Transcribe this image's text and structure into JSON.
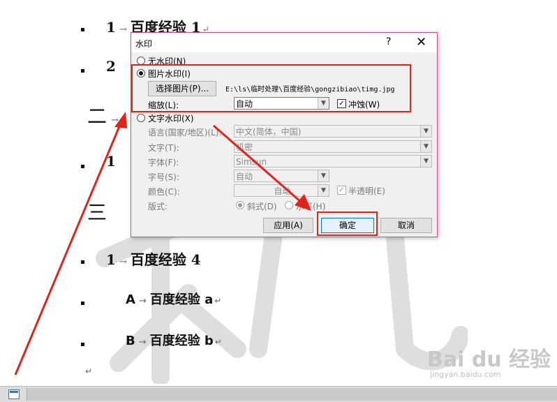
{
  "document": {
    "items": [
      {
        "num": "1",
        "text": "百度经验 1"
      },
      {
        "num": "2",
        "text": ""
      },
      {
        "num": "1",
        "text": ""
      },
      {
        "num": "1",
        "text": "百度经验 4"
      },
      {
        "num": "A",
        "text": "百度经验 a"
      },
      {
        "num": "B",
        "text": "百度经验 b"
      }
    ],
    "headings": [
      {
        "num": "二",
        "text": ""
      },
      {
        "num": "三",
        "text": ""
      }
    ],
    "arrow": "→",
    "para_mark": "↵",
    "watermark_text": "机密"
  },
  "dialog": {
    "title": "水印",
    "help": "?",
    "close": "✕",
    "no_watermark": "无水印(N)",
    "picture_watermark": "图片水印(I)",
    "select_picture": "选择图片(P)...",
    "picture_path": "E:\\ls\\临时处理\\百度经验\\gongzibiao\\timg.jpg",
    "scale_label": "缩放(L):",
    "scale_value": "自动",
    "washout_label": "冲蚀(W)",
    "text_watermark": "文字水印(X)",
    "language_label": "语言(国家/地区)(L):",
    "language_value": "中文(简体，中国)",
    "text_label": "文字(T):",
    "text_value": "机密",
    "font_label": "字体(F):",
    "font_value": "Simsun",
    "size_label": "字号(S):",
    "size_value": "自动",
    "color_label": "颜色(C):",
    "color_value": "自动",
    "semitransparent_label": "半透明(E)",
    "layout_label": "版式:",
    "diagonal_label": "斜式(D)",
    "horizontal_label": "水平(H)",
    "apply": "应用(A)",
    "ok": "确定",
    "cancel": "取消"
  },
  "logo": {
    "brand": "Bai du 经验",
    "url": "jingyan.baidu.com"
  },
  "colors": {
    "annotation_red": "#e2231a",
    "dialog_border": "#d04c86",
    "watermark_gray": "#d9d9d9"
  }
}
